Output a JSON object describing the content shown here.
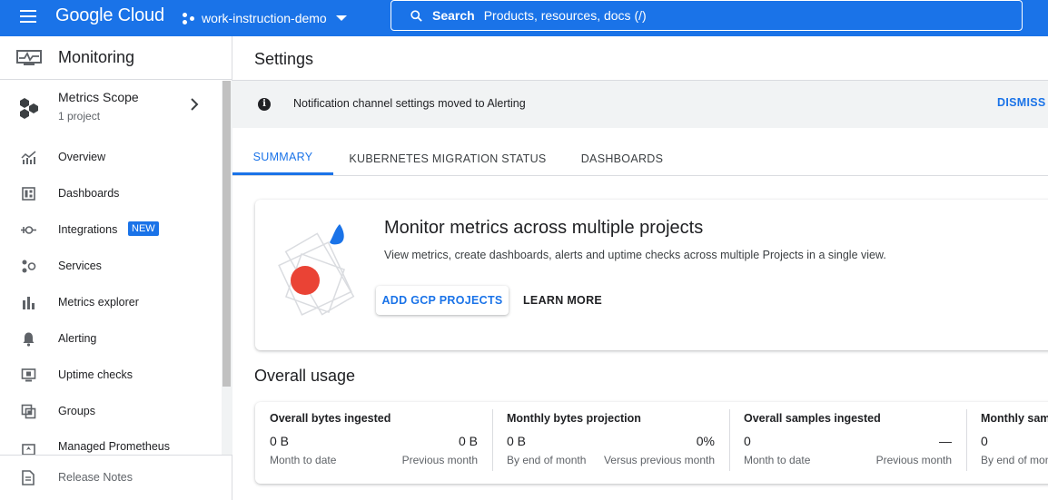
{
  "topbar": {
    "logo": "Google Cloud",
    "project": "work-instruction-demo",
    "search_label": "Search",
    "search_placeholder": "Products, resources, docs (/)"
  },
  "sidebar": {
    "title": "Monitoring",
    "scope": {
      "title": "Metrics Scope",
      "subtitle": "1 project"
    },
    "items": [
      {
        "label": "Overview",
        "icon": "chart-icon"
      },
      {
        "label": "Dashboards",
        "icon": "dashboard-icon"
      },
      {
        "label": "Integrations",
        "icon": "integrations-icon",
        "badge": "NEW"
      },
      {
        "label": "Services",
        "icon": "services-icon"
      },
      {
        "label": "Metrics explorer",
        "icon": "bar-chart-icon"
      },
      {
        "label": "Alerting",
        "icon": "bell-icon"
      },
      {
        "label": "Uptime checks",
        "icon": "monitor-icon"
      },
      {
        "label": "Groups",
        "icon": "groups-icon"
      },
      {
        "label": "Managed Prometheus",
        "icon": "prometheus-icon"
      }
    ],
    "release_notes": "Release Notes"
  },
  "main": {
    "title": "Settings",
    "banner": {
      "message": "Notification channel settings moved to Alerting",
      "dismiss": "DISMISS"
    },
    "tabs": [
      {
        "label": "SUMMARY",
        "active": true
      },
      {
        "label": "KUBERNETES MIGRATION STATUS",
        "active": false
      },
      {
        "label": "DASHBOARDS",
        "active": false
      }
    ],
    "promo": {
      "title": "Monitor metrics across multiple projects",
      "description": "View metrics, create dashboards, alerts and uptime checks across multiple Projects in a single view.",
      "primary_button": "ADD GCP PROJECTS",
      "secondary_button": "LEARN MORE"
    },
    "usage": {
      "title": "Overall usage",
      "metrics": [
        {
          "title": "Overall bytes ingested",
          "value1": "0 B",
          "label1": "Month to date",
          "value2": "0 B",
          "label2": "Previous month"
        },
        {
          "title": "Monthly bytes projection",
          "value1": "0 B",
          "label1": "By end of month",
          "value2": "0%",
          "label2": "Versus previous month"
        },
        {
          "title": "Overall samples ingested",
          "value1": "0",
          "label1": "Month to date",
          "value2": "—",
          "label2": "Previous month"
        },
        {
          "title": "Monthly samples projection",
          "value1": "0",
          "label1": "By end of month",
          "value2": "",
          "label2": ""
        }
      ]
    }
  },
  "colors": {
    "brand": "#1a73e8",
    "banner_bg": "#f1f3f4",
    "accent_red": "#ea4335"
  }
}
